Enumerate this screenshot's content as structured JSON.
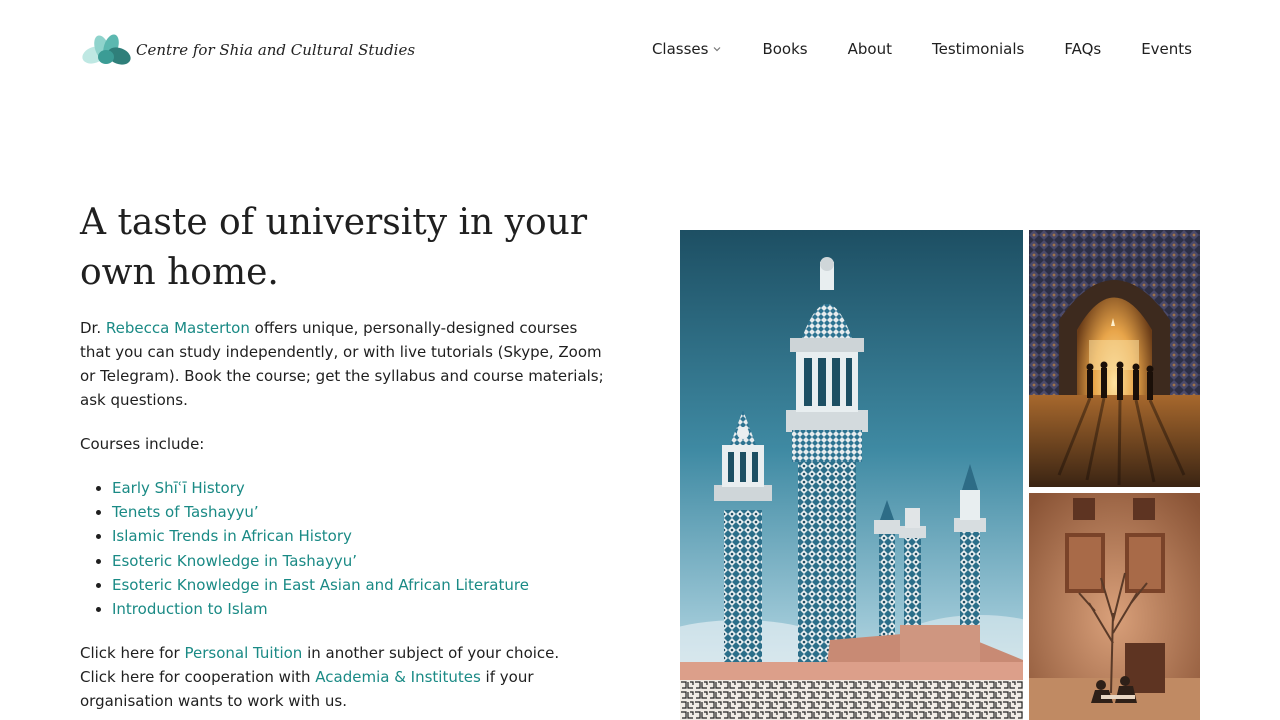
{
  "brand": {
    "name": "Centre for Shia and Cultural Studies",
    "logo_icon": "lotus-icon",
    "colors": {
      "teal": "#1a8a85",
      "light_teal": "#8fd3cc",
      "dark_teal": "#2f7f7a"
    }
  },
  "nav": {
    "items": [
      {
        "label": "Classes",
        "has_dropdown": true
      },
      {
        "label": "Books"
      },
      {
        "label": "About"
      },
      {
        "label": "Testimonials"
      },
      {
        "label": "FAQs"
      },
      {
        "label": "Events"
      }
    ]
  },
  "hero": {
    "title": "A taste of university in your own home.",
    "intro": {
      "prefix": "Dr. ",
      "person_link": "Rebecca Masterton",
      "suffix": " offers unique, personally-designed courses that you can study independently, or with live tutorials (Skype, Zoom or Telegram). Book the course; get the syllabus and course materials; ask questions."
    },
    "courses_heading": "Courses include:",
    "courses": [
      "Early Shīʿī History",
      "Tenets of Tashayyu’",
      "Islamic Trends in African History",
      "Esoteric Knowledge in Tashayyu’",
      "Esoteric Knowledge in East Asian and African Literature",
      "Introduction to Islam"
    ],
    "tuition": {
      "prefix": "Click here for ",
      "link": "Personal Tuition",
      "suffix": " in another subject of your choice."
    },
    "cooperation": {
      "prefix": "Click here for cooperation with ",
      "link": "Academia & Institutes",
      "suffix": " if your organisation wants to work with us."
    }
  },
  "images": [
    {
      "name": "mosque-minarets-photo",
      "alt": "Tiled minarets against blue sky"
    },
    {
      "name": "shrine-archway-photo",
      "alt": "People walking through a golden archway"
    },
    {
      "name": "courtyard-photo",
      "alt": "Courtyard with tree and terracotta walls"
    }
  ]
}
